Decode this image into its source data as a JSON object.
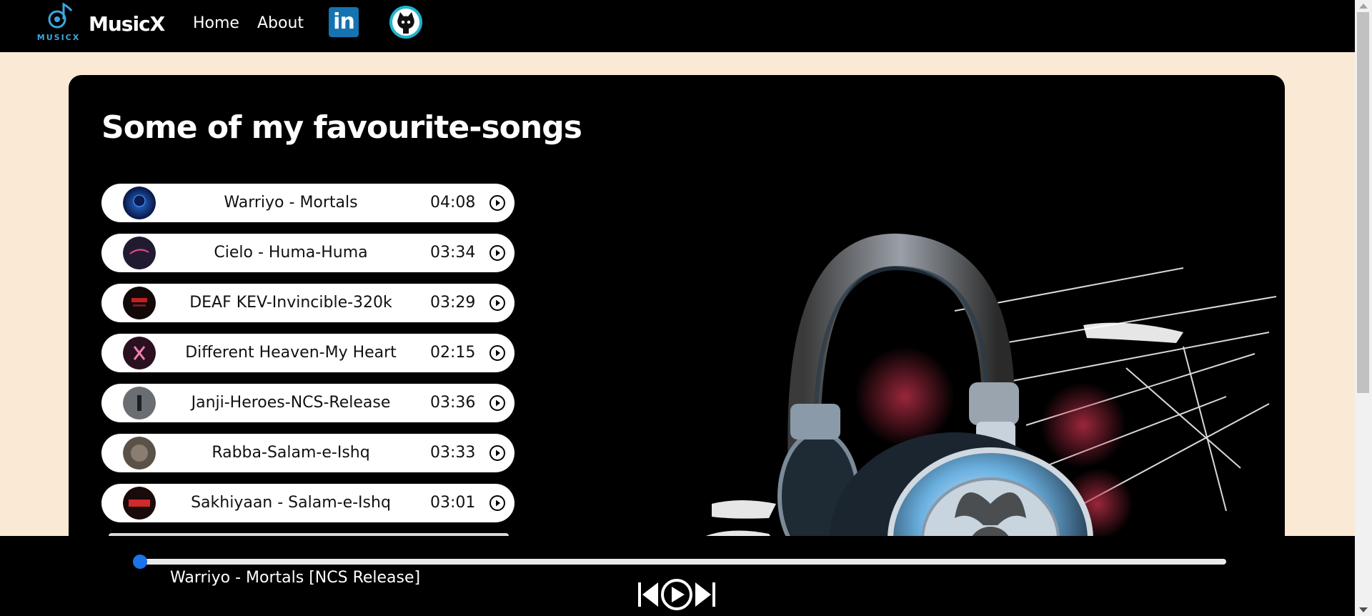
{
  "nav": {
    "brand_logo_text": "MUSICX",
    "brand_name": "MusicX",
    "links": [
      "Home",
      "About"
    ],
    "social": [
      "linkedin-icon",
      "github-icon"
    ],
    "linkedin_glyph": "in"
  },
  "main": {
    "title": "Some of my favourite-songs",
    "songs": [
      {
        "name": "Warriyo - Mortals",
        "duration": "04:08"
      },
      {
        "name": "Cielo - Huma-Huma",
        "duration": "03:34"
      },
      {
        "name": "DEAF KEV-Invincible-320k",
        "duration": "03:29"
      },
      {
        "name": "Different Heaven-My Heart",
        "duration": "02:15"
      },
      {
        "name": "Janji-Heroes-NCS-Release",
        "duration": "03:36"
      },
      {
        "name": "Rabba-Salam-e-Ishq",
        "duration": "03:33"
      },
      {
        "name": "Sakhiyaan - Salam-e-Ishq",
        "duration": "03:01"
      }
    ]
  },
  "player": {
    "now_playing": "Warriyo - Mortals [NCS Release]",
    "progress_fraction": 0,
    "controls": [
      "previous-icon",
      "play-icon",
      "next-icon"
    ]
  },
  "colors": {
    "page_bg": "#faead5",
    "card_bg": "#000000",
    "accent": "#1a73e8",
    "linkedin": "#1673b1",
    "github": "#1fb3cc"
  }
}
